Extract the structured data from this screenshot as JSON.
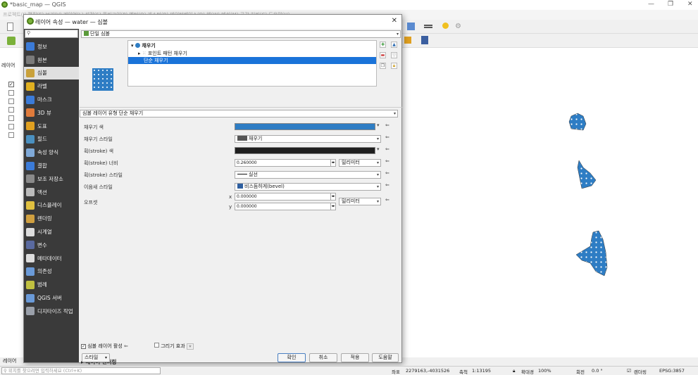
{
  "window": {
    "title": "*basic_map — QGIS"
  },
  "menubar": {
    "text": "프로젝트(J) 편집(E) 보기(V) 레이어(L) 설정(S) 플러그인(P) 벡터(O) 래스터(R) 데이터베이스(D) 웹(W) 메쉬(M) 공간 처리(C) 도움말(H)"
  },
  "layers_panel": {
    "title": "레이어",
    "bottom_tab": "레이어"
  },
  "dialog": {
    "title": "레이어 속성 — water — 심볼",
    "close": "✕",
    "renderer_combo": "단일 심볼",
    "sidebar": [
      {
        "label": "정보",
        "color": "#3b7bd8"
      },
      {
        "label": "원본",
        "color": "#7a7a7a"
      },
      {
        "label": "심볼",
        "color": "#c9a13b"
      },
      {
        "label": "라벨",
        "color": "#e0b020"
      },
      {
        "label": "마스크",
        "color": "#3b7bd8"
      },
      {
        "label": "3D 뷰",
        "color": "#e07b3b"
      },
      {
        "label": "도표",
        "color": "#e0a020"
      },
      {
        "label": "필드",
        "color": "#4a90c0"
      },
      {
        "label": "속성 양식",
        "color": "#7fa9d8"
      },
      {
        "label": "결합",
        "color": "#3b7bd8"
      },
      {
        "label": "보조 저장소",
        "color": "#8a8a8a"
      },
      {
        "label": "액션",
        "color": "#bbbbbb"
      },
      {
        "label": "디스플레이",
        "color": "#e0c040"
      },
      {
        "label": "렌더링",
        "color": "#d0a040"
      },
      {
        "label": "시계열",
        "color": "#dddddd"
      },
      {
        "label": "변수",
        "color": "#5a6aa0"
      },
      {
        "label": "메타데이터",
        "color": "#dddddd"
      },
      {
        "label": "의존성",
        "color": "#6a9ad8"
      },
      {
        "label": "범례",
        "color": "#c0c040"
      },
      {
        "label": "QGIS 서버",
        "color": "#6a9ad8"
      },
      {
        "label": "디지타이즈 작업",
        "color": "#9aa0aa"
      }
    ],
    "symbol_tree": {
      "root": "채우기",
      "child1": "포인트 패턴 채우기",
      "child2": "단순 채우기"
    },
    "symbol_layer_type": "심볼 레이어 유형  단순 채우기",
    "props": {
      "fill_color_label": "채우기 색",
      "fill_style_label": "채우기 스타일",
      "fill_style_value": "채우기",
      "stroke_color_label": "획(stroke) 색",
      "stroke_width_label": "획(stroke) 너비",
      "stroke_width_value": "0.260000",
      "stroke_width_unit": "밀리미터",
      "stroke_style_label": "획(stroke) 스타일",
      "stroke_style_value": "실선",
      "join_style_label": "이음새 스타일",
      "join_style_value": "비스듬하게(bevel)",
      "offset_label": "오프셋",
      "offset_x_label": "x",
      "offset_y_label": "y",
      "offset_x": "0.000000",
      "offset_y": "0.000000",
      "offset_unit": "밀리미터"
    },
    "enable_layer_label": "심볼 레이어 활성",
    "draw_effects_label": "그리기 효과",
    "layer_rendering": "레이어 렌더링",
    "buttons": {
      "style": "스타일",
      "ok": "확인",
      "cancel": "취소",
      "apply": "적용",
      "help": "도움말"
    }
  },
  "statusbar": {
    "locator_placeholder": "위치를 찾으려면 입력하세요 (Ctrl+K)",
    "coord_label": "좌표",
    "coord_value": "2279163,-4031526",
    "scale_label": "축척",
    "scale_value": "1:13195",
    "magnifier_label": "확대경",
    "magnifier_value": "100%",
    "rotation_label": "회전",
    "rotation_value": "0.0 °",
    "render_label": "렌더링",
    "crs": "EPSG:3857"
  },
  "colors": {
    "fill": "#2e7dc4",
    "selection": "#1a73d9",
    "sidebar_bg": "#3a3a3a"
  }
}
